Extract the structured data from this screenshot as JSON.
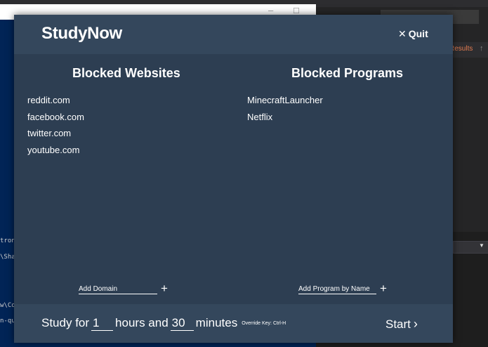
{
  "app": {
    "title": "StudyNow",
    "quit_label": "Quit"
  },
  "websites": {
    "heading": "Blocked Websites",
    "items": [
      "reddit.com",
      "facebook.com",
      "twitter.com",
      "youtube.com"
    ],
    "add_placeholder": "Add Domain"
  },
  "programs": {
    "heading": "Blocked Programs",
    "items": [
      "MinecraftLauncher",
      "Netflix"
    ],
    "add_placeholder": "Add Program by Name"
  },
  "footer": {
    "study_prefix": "Study for",
    "hours_value": "1",
    "hours_label": "hours and",
    "minutes_value": "30",
    "minutes_label": "minutes",
    "override_key": "Override Key: Ctrl-H",
    "start_label": "Start"
  },
  "background": {
    "results_label": "Results",
    "terminal_lines": [
      "tron",
      "\\Sha",
      "w\\Co",
      "n-qu"
    ]
  },
  "colors": {
    "modal_body": "#2d3e52",
    "modal_bar": "#34475c",
    "text": "#ffffff",
    "powershell_blue": "#012456",
    "results_accent": "#e07a4f"
  }
}
